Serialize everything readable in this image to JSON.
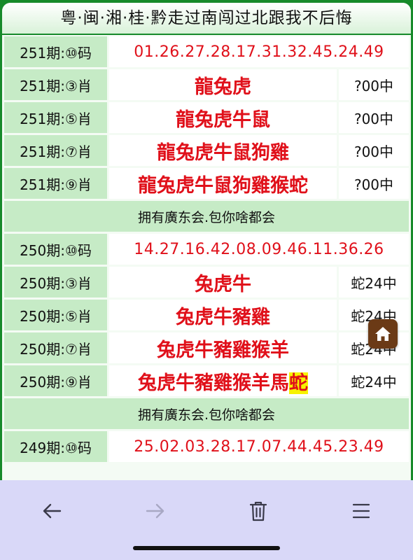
{
  "header": {
    "title": "粤·闽·湘·桂·黔走过南闯过北跟我不后悔"
  },
  "sections": [
    {
      "code_row": {
        "label": "251期:⑩码",
        "numbers": "01.26.27.28.17.31.32.45.24.49"
      },
      "rows": [
        {
          "label": "251期:③肖",
          "zodiacs": "龍兔虎",
          "result": "?00中"
        },
        {
          "label": "251期:⑤肖",
          "zodiacs": "龍兔虎牛鼠",
          "result": "?00中"
        },
        {
          "label": "251期:⑦肖",
          "zodiacs": "龍兔虎牛鼠狗雞",
          "result": "?00中"
        },
        {
          "label": "251期:⑨肖",
          "zodiacs": "龍兔虎牛鼠狗雞猴蛇",
          "result": "?00中"
        }
      ],
      "slogan": "拥有廣东会.包你啥都会"
    },
    {
      "code_row": {
        "label": "250期:⑩码",
        "numbers": "14.27.16.42.08.09.46.11.36.26"
      },
      "rows": [
        {
          "label": "250期:③肖",
          "zodiacs": "兔虎牛",
          "result": "蛇24中"
        },
        {
          "label": "250期:⑤肖",
          "zodiacs": "兔虎牛豬雞",
          "result": "蛇24中"
        },
        {
          "label": "250期:⑦肖",
          "zodiacs": "兔虎牛豬雞猴羊",
          "result": "蛇24中"
        },
        {
          "label": "250期:⑨肖",
          "zodiacs": "兔虎牛豬雞猴羊馬",
          "highlight": "蛇",
          "result": "蛇24中"
        }
      ],
      "slogan": "拥有廣东会.包你啥都会"
    },
    {
      "code_row": {
        "label": "249期:⑩码",
        "numbers": "25.02.03.28.17.07.44.45.23.49"
      }
    }
  ],
  "floating": {
    "icon": "home-icon"
  },
  "toolbar": {
    "icons": [
      "back-arrow-icon",
      "forward-arrow-icon",
      "trash-icon",
      "menu-icon"
    ]
  },
  "colors": {
    "frame_green": "#178a2a",
    "label_bg": "#c6ebc6",
    "text_red": "#e0101a",
    "highlight_yellow": "#f7f200",
    "toolbar_bg": "#d9d8f8",
    "home_button": "#6b3a16"
  }
}
